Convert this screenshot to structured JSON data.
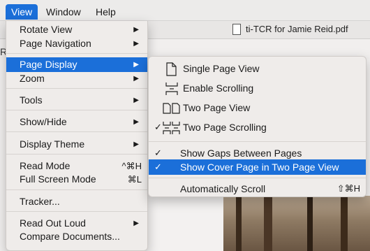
{
  "menubar": {
    "items": [
      {
        "label": "View"
      },
      {
        "label": "Window"
      },
      {
        "label": "Help"
      }
    ]
  },
  "window": {
    "doc_title": "ti-TCR for Jamie Reid.pdf",
    "toolbar_fragment": "R"
  },
  "view_menu": {
    "items": [
      {
        "label": "Rotate View",
        "submenu": "▶"
      },
      {
        "label": "Page Navigation",
        "submenu": "▶"
      },
      {
        "label": "Page Display",
        "submenu": "▶"
      },
      {
        "label": "Zoom",
        "submenu": "▶"
      },
      {
        "label": "Tools",
        "submenu": "▶"
      },
      {
        "label": "Show/Hide",
        "submenu": "▶"
      },
      {
        "label": "Display Theme",
        "submenu": "▶"
      },
      {
        "label": "Read Mode",
        "shortcut": "^⌘H"
      },
      {
        "label": "Full Screen Mode",
        "shortcut": "⌘L"
      },
      {
        "label": "Tracker..."
      },
      {
        "label": "Read Out Loud",
        "submenu": "▶"
      },
      {
        "label": "Compare Documents..."
      }
    ]
  },
  "page_display_submenu": {
    "items": [
      {
        "label": "Single Page View",
        "icon": "single-page-icon",
        "checked": false
      },
      {
        "label": "Enable Scrolling",
        "icon": "scrolling-icon",
        "checked": false
      },
      {
        "label": "Two Page View",
        "icon": "two-page-icon",
        "checked": false
      },
      {
        "label": "Two Page Scrolling",
        "icon": "two-page-scrolling-icon",
        "checked": true
      },
      {
        "label": "Show Gaps Between Pages",
        "checked": true
      },
      {
        "label": "Show Cover Page in Two Page View",
        "checked": true
      },
      {
        "label": "Automatically Scroll",
        "shortcut": "⇧⌘H",
        "checked": false
      }
    ],
    "check_mark": "✓"
  },
  "colors": {
    "highlight": "#1b6fd9",
    "menu_bg": "#efecea"
  }
}
